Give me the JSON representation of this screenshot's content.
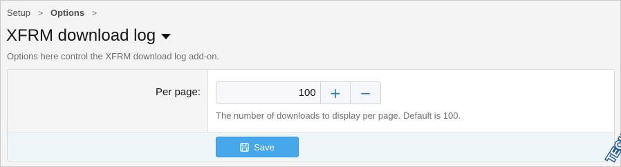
{
  "breadcrumb": {
    "items": [
      "Setup",
      "Options"
    ],
    "separator": ">"
  },
  "header": {
    "title": "XFRM download log",
    "description": "Options here control the XFRM download log add-on."
  },
  "form": {
    "per_page": {
      "label": "Per page:",
      "value": "100",
      "increment_label": "+",
      "decrement_label": "−",
      "explain": "The number of downloads to display per page. Default is 100."
    },
    "save_label": "Save"
  },
  "watermark": {
    "text": "TECHIESHOME.COM"
  },
  "colors": {
    "accent": "#47a7eb",
    "stepper_icon": "#2b7bc0",
    "submit_row_bg": "#eef6f9"
  }
}
